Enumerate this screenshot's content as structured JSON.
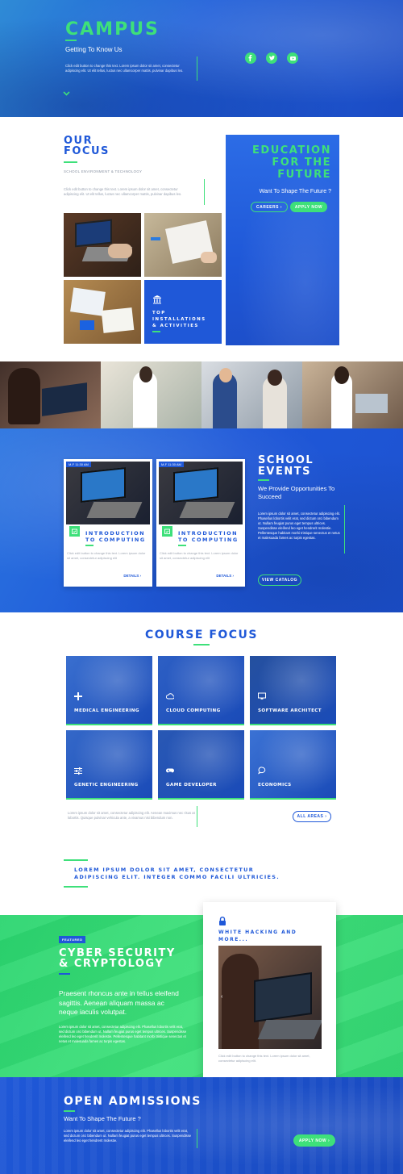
{
  "colors": {
    "blue": "#1f58d8",
    "navy": "#0c3ba3",
    "green": "#3ee07a",
    "grey": "#9aa3b2"
  },
  "hero": {
    "title": "CAMPUS",
    "subtitle": "Getting To Know Us",
    "body": "Click edit button to change this text. Lorem ipsum dolor sit amet, consectetur adipiscing elit. Ut elit tellus, luctus nec ullamcorper mattis, pulvinar dapibus leo.",
    "social": [
      "facebook-icon",
      "twitter-icon",
      "youtube-icon"
    ]
  },
  "focus": {
    "title_line1": "OUR",
    "title_line2": "FOCUS",
    "subtitle": "SCHOOL ENVIRONMENT & TECHNOLOGY",
    "body": "Click edit button to change this text. Lorem ipsum dolor sit amet, consectetur adipiscing elit. Ut elit tellus, luctus nec ullamcorper mattis, pulvinar dapibus leo.",
    "card_line1": "TOP",
    "card_line2": "INSTALLATIONS",
    "card_line3": "& ACTIVITIES"
  },
  "edu": {
    "line1": "EDUCATION",
    "line2": "FOR THE",
    "line3": "FUTURE",
    "subtitle": "Want To Shape The Future ?",
    "careers": "CAREERS",
    "apply": "APPLY NOW"
  },
  "events": {
    "title_line1": "SCHOOL",
    "title_line2": "EVENTS",
    "subtitle": "We Provide Opportunities To Succeed",
    "body": "Lorem ipsum dolor sit amet, consectetur adipiscing elit. Phasellus lobortis velit erat, sed dictum orci bibendum ut. Nullam feugiat purus eget tempus ultrices. Suspendisse eleifend leo eget hendrerit molestie. Pellentesque habitant morbi tristique senectus et netus et malesuada fames ac turpis egestas.",
    "catalog": "VIEW CATALOG",
    "cards": [
      {
        "tag": "M-F 11:30 AM",
        "title_line1": "INTRODUCTION",
        "title_line2": "TO COMPUTING",
        "body": "Click edit button to change this text. Lorem ipsum dolor sit amet, consectetur adipiscing elit",
        "details": "DETAILS"
      },
      {
        "tag": "M-F 11:30 AM",
        "title_line1": "INTRODUCTION",
        "title_line2": "TO COMPUTING",
        "body": "Click edit button to change this text. Lorem ipsum dolor sit amet, consectetur adipiscing elit",
        "details": "DETAILS"
      }
    ]
  },
  "courses": {
    "title": "COURSE FOCUS",
    "items": [
      {
        "label": "MEDICAL ENGINEERING",
        "icon": "plus-icon"
      },
      {
        "label": "CLOUD COMPUTING",
        "icon": "cloud-icon"
      },
      {
        "label": "SOFTWARE ARCHITECT",
        "icon": "monitor-icon"
      },
      {
        "label": "GENETIC ENGINEERING",
        "icon": "sliders-icon"
      },
      {
        "label": "GAME DEVELOPER",
        "icon": "gamepad-icon"
      },
      {
        "label": "ECONOMICS",
        "icon": "chat-icon"
      }
    ],
    "body": "Lorem ipsum dolor sit amet, consectetur adipiscing elit. Aenean maximus nec risus at lobortis. Quisque pulvinar vehicula ante, a vivamus nisi bibendum non.",
    "all_areas": "ALL AREAS"
  },
  "quote": "LOREM IPSUM DOLOR SIT AMET, CONSECTETUR ADIPISCING ELIT. INTEGER COMMO FACILI ULTRICIES.",
  "cyber": {
    "badge": "FEATURED",
    "title_line1": "CYBER SECURITY",
    "title_line2": "& CRYPTOLOGY",
    "lead": "Praesent rhoncus ante in tellus eleifend sagittis. Aenean aliquam massa ac neque iaculis volutpat.",
    "body": "Lorem ipsum dolor sit amet, consectetur adipiscing elit. Phasellus lobortis velit erat, sed dictum orci bibendum ut. Nullam feugiat purus eget tempus ultrices. Suspendisse eleifend leo eget hendrerit molestie. Pellentesque habitant morbi tristique senectus et netus et malesuada fames ac turpis egestas.",
    "card_title_line1": "WHITE HACKING AND",
    "card_title_line2": "MORE...",
    "card_body": "Click edit button to change this text. Lorem ipsum dolor sit amet, consectetur adipiscing elit."
  },
  "admissions": {
    "title": "OPEN ADMISSIONS",
    "subtitle": "Want To Shape The Future ?",
    "body": "Lorem ipsum dolor sit amet, consectetur adipiscing elit. Phasellus lobortis velit erat, sed dictum orci bibendum ut. Nullam feugiat purus eget tempus ultrices. Suspendisse eleifend leo eget hendrerit molestie.",
    "apply": "APPLY NOW"
  }
}
